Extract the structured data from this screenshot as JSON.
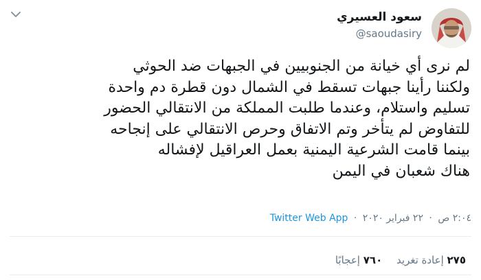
{
  "author": {
    "name": "سعود العسيري",
    "handle": "@saoudasiry"
  },
  "icons": {
    "menu": "chevron-down-icon"
  },
  "tweet": {
    "lines": [
      "لم نرى أي خيانة من الجنوبيين في الجبهات ضد الحوثي",
      "ولكننا رأينا جبهات تسقط في الشمال دون قطرة دم واحدة",
      "تسليم واستلام، وعندما طلبت المملكة من الانتقالي الحضور",
      "للتفاوض لم يتأخر وتم الاتفاق وحرص الانتقالي على إنجاحه",
      "بينما قامت الشرعية اليمنية بعمل العراقيل لإفشاله",
      "هناك شعبان في اليمن"
    ]
  },
  "meta": {
    "time": "٢:٠٤ ص",
    "separator": "·",
    "date": "٢٢ فبراير ٢٠٢٠",
    "source": "Twitter Web App"
  },
  "stats": {
    "retweets_count": "٢٧٥",
    "retweets_label": "إعادة تغريد",
    "likes_count": "٧٦٠",
    "likes_label": "إعجابًا"
  },
  "colors": {
    "text": "#14171a",
    "secondary": "#657786",
    "link": "#1b95e0",
    "divider": "#e6ecf0"
  }
}
